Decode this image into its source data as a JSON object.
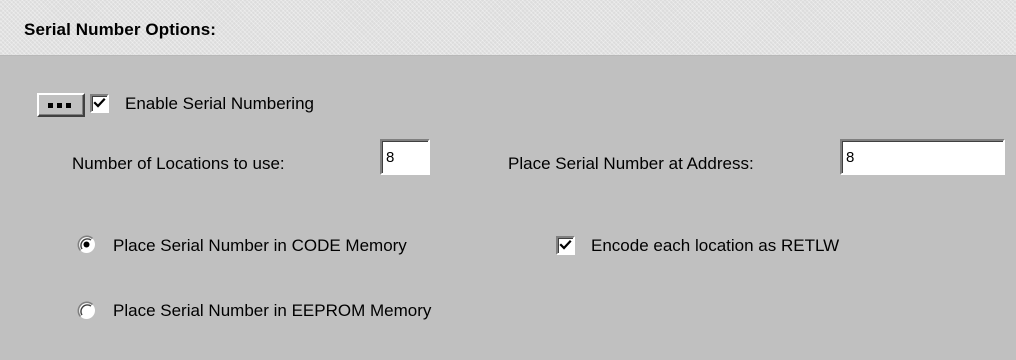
{
  "panel": {
    "title": "Serial Number Options:"
  },
  "enable": {
    "button_icon": "ellipsis-icon",
    "label": "Enable Serial Numbering",
    "checked": true
  },
  "locations": {
    "label": "Number of Locations to use:",
    "value": "8"
  },
  "address": {
    "label": "Place Serial Number at Address:",
    "value": "8"
  },
  "memory": {
    "code_label": "Place Serial Number in CODE Memory",
    "code_selected": true,
    "eeprom_label": "Place Serial Number in EEPROM Memory",
    "eeprom_selected": false
  },
  "retlw": {
    "label": "Encode each location as RETLW",
    "checked": true
  }
}
